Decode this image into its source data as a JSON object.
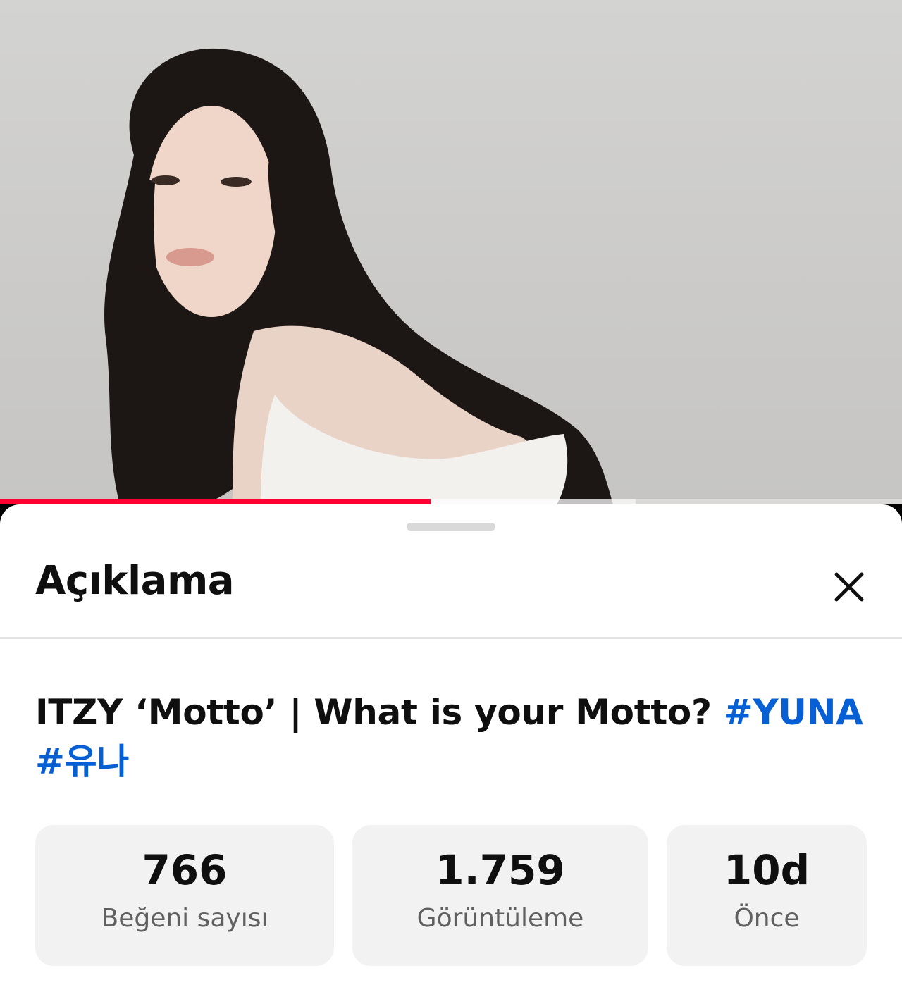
{
  "video": {
    "progress_fraction": 0.477,
    "buffered_fraction": 0.705,
    "colors": {
      "played": "#ff0033",
      "background": "#cfcecc"
    }
  },
  "description_sheet": {
    "title": "Açıklama",
    "close_icon": "close-icon",
    "video_title": {
      "text": "ITZY ‘Motto’ | What is your Motto? ",
      "hashtags": [
        "#YUNA",
        "#유나"
      ],
      "hashtag_color": "#065fd4"
    },
    "stats": [
      {
        "value": "766",
        "label": "Beğeni sayısı"
      },
      {
        "value": "1.759",
        "label": "Görüntüleme"
      },
      {
        "value": "10d",
        "label": "Önce"
      }
    ]
  }
}
